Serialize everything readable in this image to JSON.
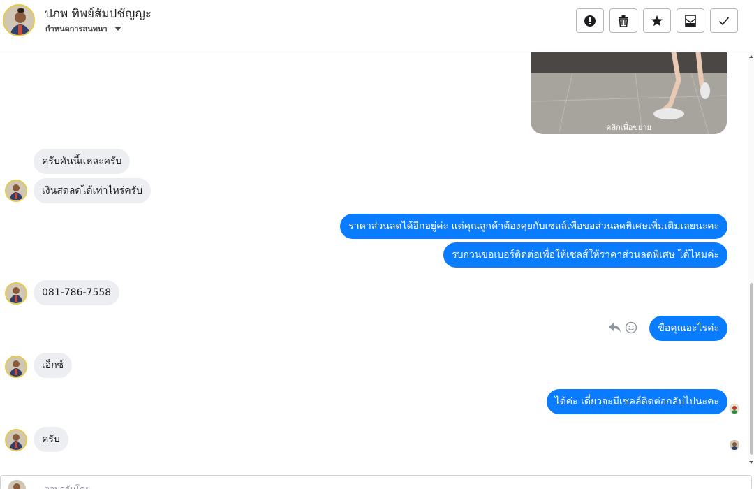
{
  "header": {
    "contact_name": "ปภพ ทิพย์สัมปชัญญะ",
    "subtitle": "กำหนดการสนทนา",
    "tools": [
      {
        "icon": "alert-icon",
        "name": "report-button"
      },
      {
        "icon": "trash-icon",
        "name": "delete-button"
      },
      {
        "icon": "star-icon",
        "name": "star-button"
      },
      {
        "icon": "mark-unread-icon",
        "name": "mark-unread-button"
      },
      {
        "icon": "check-icon",
        "name": "done-button"
      }
    ]
  },
  "image_message": {
    "caption": "คลิกเพื่อขยาย"
  },
  "messages": [
    {
      "side": "in",
      "text": "ครับคันนี้แหละครับ"
    },
    {
      "side": "in",
      "text": "เงินสดลดได้เท่าไหร่ครับ"
    },
    {
      "side": "out",
      "text": "ราคาส่วนลดได้อีกอยู่ค่ะ แต่คุณลูกค้าต้องคุยกับเซลล์เพื่อขอส่วนลดพิเศษเพิ่มเติมเลยนะคะ"
    },
    {
      "side": "out",
      "text": "รบกวนขอเบอร์ติดต่อเพื่อให้เซลส์ให้ราคาส่วนลดพิเศษ ได้ไหมค่ะ"
    },
    {
      "side": "in",
      "text": "081-786-7558"
    },
    {
      "side": "out",
      "text": "ขื่อคุณอะไรค่ะ"
    },
    {
      "side": "in",
      "text": "เอ็กซ์"
    },
    {
      "side": "out",
      "text": "ได้ค่ะ เดี๋ยวจะมีเซลล์ติดต่อกลับไปนะคะ"
    },
    {
      "side": "in",
      "text": "ครับ"
    }
  ],
  "composer": {
    "placeholder": "ตอบกลับโดย..."
  },
  "colors": {
    "outgoing_bubble": "#0a7cff",
    "incoming_bubble": "#eceef1",
    "avatar_ring": "#e6c84a"
  }
}
